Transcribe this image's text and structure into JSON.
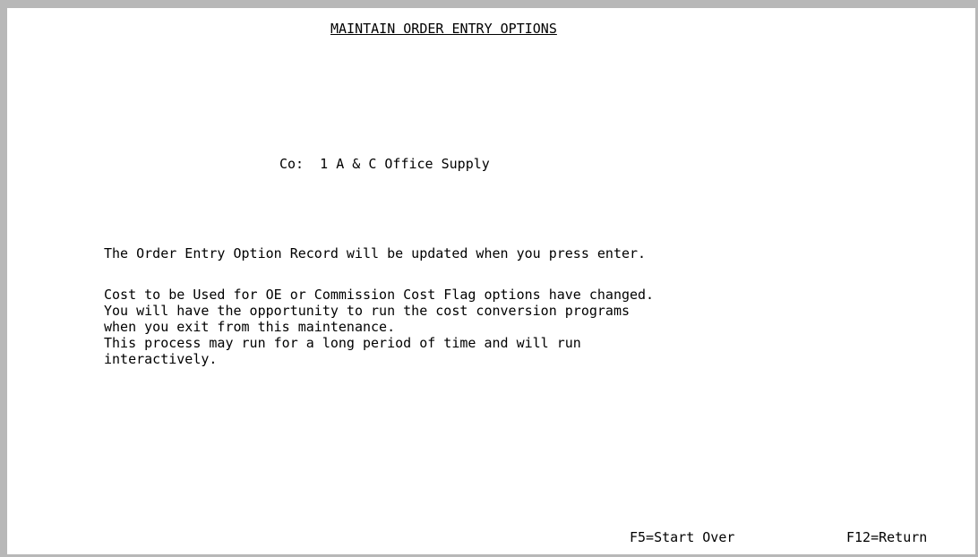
{
  "screen": {
    "title": "MAINTAIN ORDER ENTRY OPTIONS",
    "company_label": "Co:",
    "company_number": "1",
    "company_name": "A & C Office Supply"
  },
  "messages": {
    "update_notice": "The Order Entry Option Record will be updated when you press enter.",
    "cost_lines": [
      "Cost to be Used for OE or Commission Cost Flag options have changed.",
      "You will have the opportunity to run the cost conversion programs",
      "when you exit from this maintenance.",
      "This process may run for a long period of time and will run",
      "interactively."
    ]
  },
  "function_keys": {
    "f5": "F5=Start Over",
    "f12": "F12=Return"
  }
}
